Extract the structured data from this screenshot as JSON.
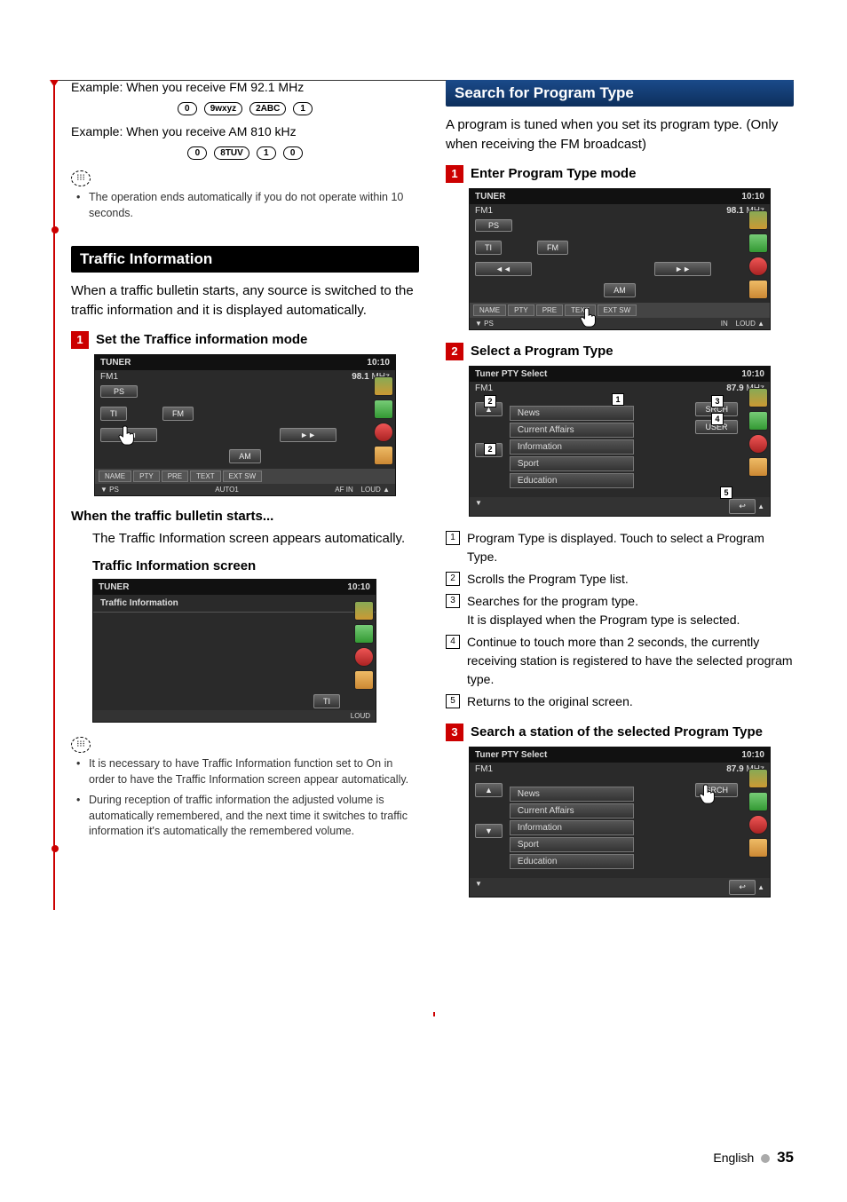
{
  "left": {
    "example1": {
      "text": "Example: When you receive FM 92.1 MHz",
      "keys": [
        "0",
        "9wxyz",
        "2ABC",
        "1"
      ]
    },
    "example2": {
      "text": "Example: When you receive AM 810 kHz",
      "keys": [
        "0",
        "8TUV",
        "1",
        "0"
      ]
    },
    "note1": "The operation ends automatically if you do not operate within 10 seconds.",
    "traffic_header": "Traffic Information",
    "traffic_intro": "When a traffic bulletin starts, any source is switched to the traffic information and it is displayed automatically.",
    "step1_title": "Set the Traffice information mode",
    "screenshot1": {
      "title": "TUNER",
      "clock": "10:10",
      "band": "FM1",
      "freq": "98.1",
      "unit": "MHz",
      "ps": "PS",
      "btn_ti": "TI",
      "btn_fm": "FM",
      "btn_am": "AM",
      "prev": "◄◄",
      "next": "►►",
      "tabs": [
        "NAME",
        "PTY",
        "PRE",
        "TEXT",
        "EXT SW"
      ],
      "bl": "PS",
      "bm": "AUTO1",
      "br_af": "AF",
      "br_in": "IN",
      "br_loud": "LOUD"
    },
    "bulletin_heading": "When the traffic bulletin starts...",
    "bulletin_text": "The Traffic Information screen appears automatically.",
    "ti_screen_heading": "Traffic Information screen",
    "screenshot2": {
      "title": "TUNER",
      "clock": "10:10",
      "label": "Traffic Information",
      "btn_ti": "TI",
      "loud": "LOUD"
    },
    "notes2": [
      "It is necessary to have Traffic Information function set to On in order to have the Traffic Information screen appear automatically.",
      "During reception of traffic information the adjusted volume is automatically remembered, and the next time it switches to traffic information it's automatically the remembered volume."
    ]
  },
  "right": {
    "header": "Search for Program Type",
    "intro": "A program is tuned when you set its program type. (Only when receiving the FM broadcast)",
    "step1": "Enter Program Type mode",
    "screenshot3": {
      "title": "TUNER",
      "clock": "10:10",
      "band": "FM1",
      "freq": "98.1",
      "unit": "MHz",
      "ps": "PS",
      "btn_ti": "TI",
      "btn_fm": "FM",
      "btn_am": "AM",
      "prev": "◄◄",
      "next": "►►",
      "tabs": [
        "NAME",
        "PTY",
        "PRE",
        "TEXT",
        "EXT SW"
      ],
      "bl": "PS",
      "br_in": "IN",
      "br_loud": "LOUD"
    },
    "step2": "Select a Program Type",
    "screenshot4": {
      "title": "Tuner PTY Select",
      "clock": "10:10",
      "band": "FM1",
      "freq": "87.9",
      "unit": "MHz",
      "srch": "SRCH",
      "user": "USER",
      "items": [
        "News",
        "Current Affairs",
        "Information",
        "Sport",
        "Education"
      ]
    },
    "callouts": [
      "Program Type is displayed. Touch to select a Program Type.",
      "Scrolls the Program Type list.",
      "Searches for the program type.\nIt is displayed when the Program type is selected.",
      "Continue to touch more than 2 seconds, the currently receiving station is registered to have the selected program type.",
      "Returns to the original screen."
    ],
    "step3": "Search a station of the selected Program Type",
    "screenshot5": {
      "title": "Tuner PTY Select",
      "clock": "10:10",
      "band": "FM1",
      "freq": "87.9",
      "unit": "MHz",
      "srch": "SRCH",
      "items": [
        "News",
        "Current Affairs",
        "Information",
        "Sport",
        "Education"
      ]
    }
  },
  "footer": {
    "lang": "English",
    "page": "35"
  }
}
